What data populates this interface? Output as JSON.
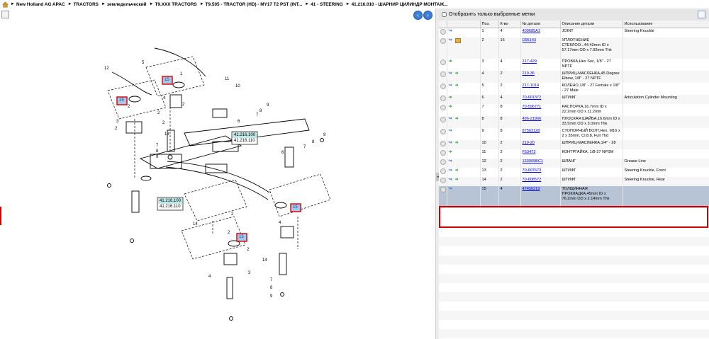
{
  "breadcrumb": {
    "items": [
      "New Holland AG APAC",
      "TRACTORS",
      "земледельческий",
      "T9.XXX TRACTORS",
      "T9.505 - TRACTOR (HD) - MY17 T2 PST (INT...",
      "41 - STEERING",
      "41.216.010 - ШАРНИР ЦИЛИНДР МОНТАЖ..."
    ]
  },
  "filter": {
    "label": "Отобразить только выбранные метки"
  },
  "diagram": {
    "callouts": [
      "1",
      "2",
      "3",
      "4",
      "5",
      "6",
      "7",
      "8",
      "9",
      "10",
      "11",
      "12",
      "13",
      "14",
      "15"
    ],
    "ref1": "41.216.100",
    "ref1b": "41.216.110",
    "ref2": "41.216.100",
    "ref2b": "41.216.110",
    "highlight": "15"
  },
  "table": {
    "columns": [
      "",
      "",
      "Поз.",
      "К-во",
      "№ детали",
      "Описание детали",
      "Использование"
    ],
    "rows": [
      {
        "pos": "1",
        "qty": "4",
        "part": "409685A1",
        "desc": "JOINT",
        "use": "Steering Knuckle",
        "icons": [
          "blue"
        ]
      },
      {
        "pos": "2",
        "qty": "16",
        "part": "D95143",
        "desc": "УПЛОТНЕНИЕ СТЕКЛОО...44.42mm ID x 57.17mm OD x 7.92mm Thk",
        "use": "",
        "icons": [
          "blue",
          "box"
        ]
      },
      {
        "pos": "3",
        "qty": "4",
        "part": "217-429",
        "desc": "ПРОБКА,Hex Soc, 1/8\" - 27 NPTF",
        "use": "",
        "icons": [
          "green"
        ]
      },
      {
        "pos": "4",
        "qty": "2",
        "part": "219-36",
        "desc": "ШПРИЦ-МАСЛЕНКА,45 Degree Elbow, 1/8\" - 27 NPTF",
        "use": "",
        "icons": [
          "blue",
          "green"
        ]
      },
      {
        "pos": "5",
        "qty": "2",
        "part": "217-1014",
        "desc": "КОЛЕНО,1/8\" - 27 Female x 1/8\" - 27 Male",
        "use": "",
        "icons": [
          "blue",
          "green"
        ]
      },
      {
        "pos": "6",
        "qty": "4",
        "part": "70-601372",
        "desc": "ШТИФТ",
        "use": "Articulation Cylinder Mounting",
        "icons": [
          "green"
        ]
      },
      {
        "pos": "7",
        "qty": "8",
        "part": "70-596771",
        "desc": "РАСПОРКА,16.7mm ID x 22.2mm OD x 11.2mm",
        "use": "",
        "icons": [
          "green"
        ]
      },
      {
        "pos": "8",
        "qty": "8",
        "part": "496-21966",
        "desc": "ПЛОСКАЯ ШАЙБА,16.6mm ID x 33.5mm OD x 3.0mm Thk",
        "use": "",
        "icons": [
          "blue",
          "green"
        ]
      },
      {
        "pos": "9",
        "qty": "8",
        "part": "87563128",
        "desc": "СТОПОРНЫЙ БОЛТ,Hex, M16 x 2 x 35mm, Cl.8.8, Full Thd",
        "use": "",
        "icons": [
          "blue"
        ]
      },
      {
        "pos": "10",
        "qty": "2",
        "part": "219-20",
        "desc": "ШПРИЦ-МАСЛЕНКА,1/4\" - 28",
        "use": "",
        "icons": [
          "blue",
          "green"
        ]
      },
      {
        "pos": "11",
        "qty": "2",
        "part": "F53473",
        "desc": "КОНТРГАЙКА, 1/8-27 NPSM",
        "use": "",
        "icons": [
          "green"
        ]
      },
      {
        "pos": "12",
        "qty": "2",
        "part": "133909BC1",
        "desc": "ШЛАНГ",
        "use": "Grease Line",
        "icons": [
          "blue"
        ]
      },
      {
        "pos": "13",
        "qty": "2",
        "part": "70-607673",
        "desc": "ШТИФТ",
        "use": "Steering Knuckle, Front",
        "icons": [
          "blue",
          "green"
        ]
      },
      {
        "pos": "14",
        "qty": "2",
        "part": "70-608572",
        "desc": "ШТИФТ",
        "use": "Steering Knuckle, Rear",
        "icons": [
          "blue",
          "green"
        ]
      },
      {
        "pos": "15",
        "qty": "4",
        "part": "47456219",
        "desc": "ТОЛЩИННАЯ ПРОКЛАДКА,45mm ID x 76.2mm OD x 2.14mm Thk",
        "use": "",
        "icons": [
          "blue"
        ]
      }
    ]
  },
  "colors": {
    "accent": "#3d7fd6",
    "selection": "#b6c4d6",
    "highlight": "#d40000"
  }
}
